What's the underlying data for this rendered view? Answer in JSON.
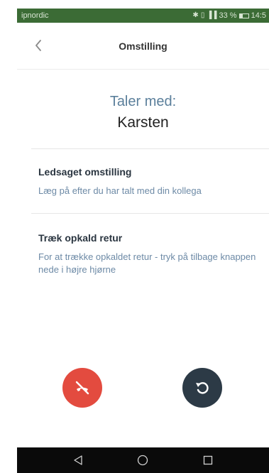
{
  "status_bar": {
    "carrier": "ipnordic",
    "icons_text": "✱ ▯̴ ⁴ᴳ.❘❙ 33 %",
    "battery_percent": "33 %",
    "time": "14:5",
    "background": "#3b6b35"
  },
  "header": {
    "title": "Omstilling",
    "back_icon": "chevron-left-icon"
  },
  "call": {
    "label": "Taler med:",
    "name": "Karsten"
  },
  "sections": [
    {
      "title": "Ledsaget omstilling",
      "description": "Læg på efter du har talt med din kollega"
    },
    {
      "title": "Træk opkald retur",
      "description": "For at trække opkaldet retur - tryk på tilbage knappen nede i højre hjørne"
    }
  ],
  "actions": {
    "hangup": {
      "icon": "hangup-icon",
      "color": "#e34b3f"
    },
    "return": {
      "icon": "return-icon",
      "color": "#2c3a46"
    }
  },
  "nav": {
    "back": "nav-back-icon",
    "home": "nav-home-icon",
    "recents": "nav-recents-icon"
  }
}
